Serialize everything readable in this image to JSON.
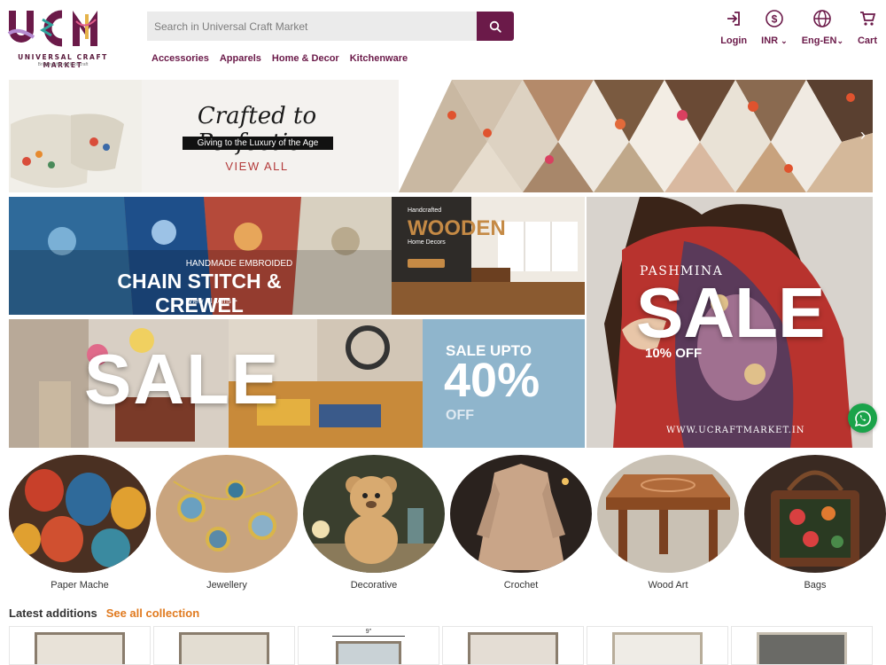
{
  "header": {
    "logo_text": "UCM",
    "logo_name": "UNIVERSAL CRAFT MARKET",
    "logo_tagline": "Bringing the world of craft",
    "search_placeholder": "Search in Universal Craft Market",
    "nav": [
      "Accessories",
      "Apparels",
      "Home & Decor",
      "Kitchenware"
    ],
    "actions": {
      "login": "Login",
      "currency": "INR",
      "language": "Eng-EN",
      "cart": "Cart"
    }
  },
  "hero": {
    "title": "Crafted to Perfection",
    "subtitle": "Giving to the Luxury of the Age",
    "cta": "VIEW ALL"
  },
  "promos": {
    "chain": {
      "subtitle": "HANDMADE EMBROIDED",
      "title": "CHAIN STITCH & CREWEL",
      "link": "View all items >"
    },
    "wooden": {
      "small": "Handcrafted",
      "title": "WOODEN",
      "subtitle": "Home Decors"
    },
    "sale": {
      "title": "SALE"
    },
    "sale40": {
      "top": "SALE UPTO",
      "value": "40%",
      "bottom": "OFF"
    },
    "pashmina": {
      "small": "PASHMINA",
      "title": "SALE",
      "off": "10% OFF",
      "url": "WWW.UCRAFTMARKET.IN"
    }
  },
  "categories": [
    "Paper Mache",
    "Jewellery",
    "Decorative",
    "Crochet",
    "Wood Art",
    "Bags"
  ],
  "latest": {
    "title": "Latest additions",
    "link": "See all collection",
    "product_note": "9\""
  },
  "colors": {
    "brand": "#6b1a49",
    "accent": "#e07a1f",
    "whatsapp": "#1aa34a"
  }
}
